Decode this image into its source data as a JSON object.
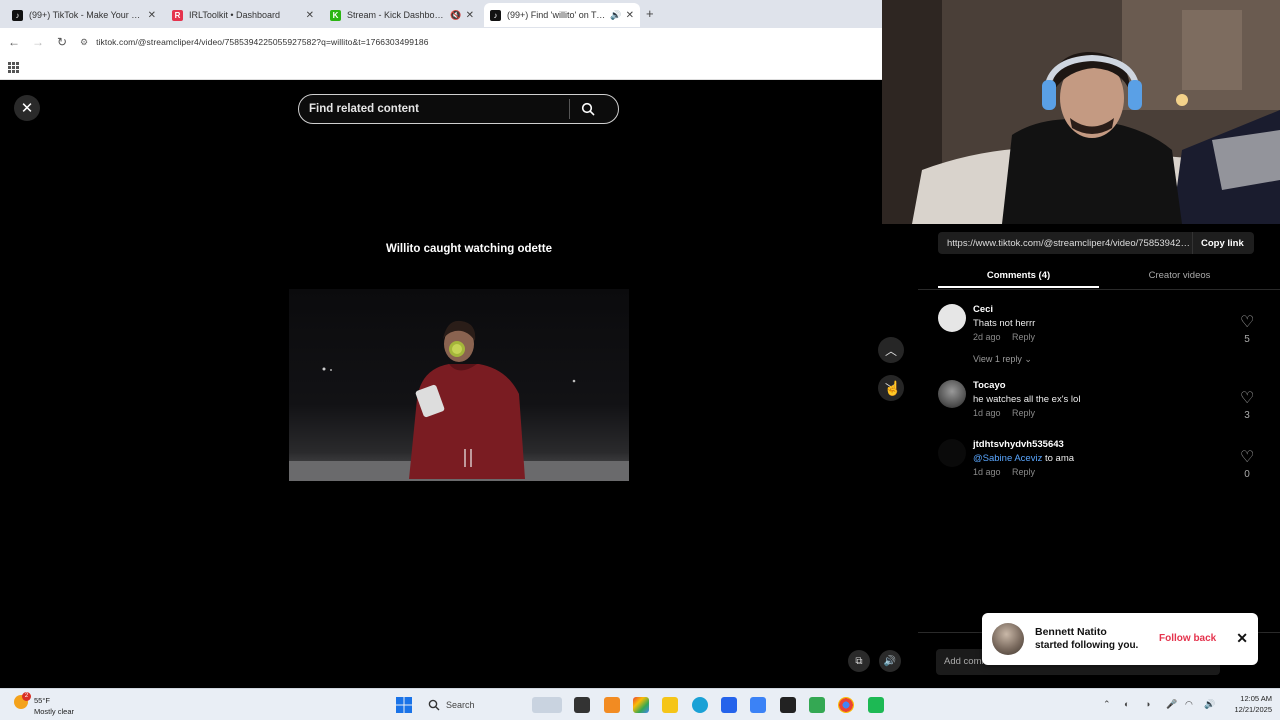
{
  "browser": {
    "tabs": [
      {
        "label": "(99+) TikTok - Make Your Day",
        "favicon": "tiktok-icon",
        "color": "#111111"
      },
      {
        "label": "IRLToolkit • Dashboard",
        "favicon": "irltoolkit-icon",
        "color": "#e5334d"
      },
      {
        "label": "Stream - Kick Dashboard",
        "favicon": "kick-icon",
        "color": "#53fc18"
      },
      {
        "label": "(99+) Find 'willito' on TikTok",
        "favicon": "tiktok-icon",
        "color": "#111111"
      }
    ],
    "url": "tiktok.com/@streamcliper4/video/7585394225055927582?q=willito&t=1766303499186"
  },
  "viewer": {
    "search_placeholder": "Find related content",
    "caption": "Willito caught watching odette"
  },
  "panel": {
    "link": "https://www.tiktok.com/@streamcliper4/video/7585394225055927582",
    "copy_label": "Copy link",
    "tabs": [
      "Comments (4)",
      "Creator videos"
    ],
    "comments": [
      {
        "name": "Ceci",
        "text": "Thats not herrr",
        "time": "2d ago",
        "reply": "Reply",
        "likes": "5"
      },
      {
        "name": "Tocayo",
        "text": "he watches all the ex's lol",
        "time": "1d ago",
        "reply": "Reply",
        "likes": "3"
      },
      {
        "name": "jtdhtsvhydvh535643",
        "mention": "@Sabine Aceviz",
        "text": " to ama",
        "time": "1d ago",
        "reply": "Reply",
        "likes": "0"
      }
    ],
    "view_replies": "View 1 reply",
    "add_comment": "Add comment..."
  },
  "toast": {
    "name": "Bennett Natito",
    "message": "started following you.",
    "action": "Follow back"
  },
  "taskbar": {
    "temp": "55°F",
    "condition": "Mostly clear",
    "search": "Search",
    "badge": "2",
    "time": "12:05 AM",
    "date": "12/21/2025"
  }
}
